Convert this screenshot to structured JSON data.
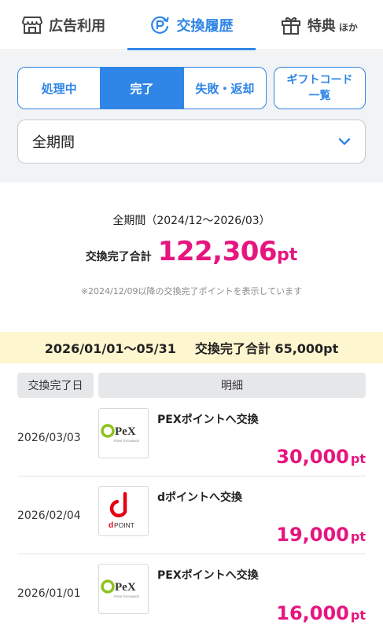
{
  "top_tabs": [
    {
      "label": "広告利用",
      "icon": "store-icon",
      "active": false
    },
    {
      "label": "交換履歴",
      "icon": "point-exchange-icon",
      "active": true
    },
    {
      "label": "特典",
      "suffix": "ほか",
      "icon": "gift-icon",
      "active": false
    }
  ],
  "filters": {
    "status": [
      "処理中",
      "完了",
      "失敗・返却"
    ],
    "active_status": "完了",
    "gift_code_line1": "ギフトコード",
    "gift_code_line2": "一覧",
    "period": "全期間"
  },
  "summary": {
    "period_text": "全期間（2024/12〜2026/03）",
    "total_label": "交換完了合計",
    "total_value": "122,306",
    "total_unit": "pt",
    "note": "※2024/12/09以降の交換完了ポイントを表示しています"
  },
  "band": {
    "range": "2026/01/01〜05/31",
    "total": "交換完了合計 65,000pt"
  },
  "table": {
    "headers": {
      "date": "交換完了日",
      "detail": "明細"
    },
    "rows": [
      {
        "date": "2026/03/03",
        "logo": "pex-logo",
        "logo_text": "PeX",
        "logo_sub": "POINT EXCHANGE",
        "title": "PEXポイントへ交換",
        "amount": "30,000",
        "unit": "pt"
      },
      {
        "date": "2026/02/04",
        "logo": "dpoint-logo",
        "logo_text": "d",
        "logo_sub": "POINT",
        "title": "dポイントへ交換",
        "amount": "19,000",
        "unit": "pt"
      },
      {
        "date": "2026/01/01",
        "logo": "pex-logo",
        "logo_text": "PeX",
        "logo_sub": "POINT EXCHANGE",
        "title": "PEXポイントへ交換",
        "amount": "16,000",
        "unit": "pt"
      }
    ]
  },
  "colors": {
    "accent": "#2f86e6",
    "amount": "#e6157f",
    "band": "#fdf6cf",
    "dpoint": "#e60012",
    "pex_green": "#8dc21f"
  }
}
